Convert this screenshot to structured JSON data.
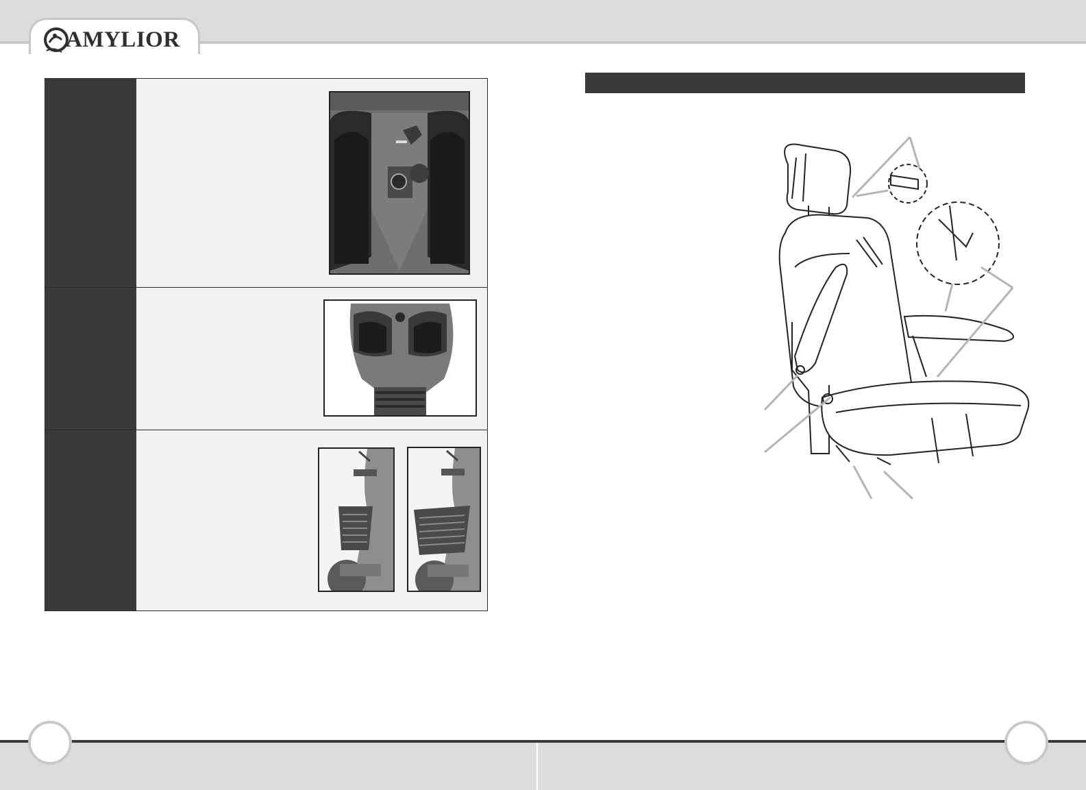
{
  "header": {
    "brand": "AMYLIOR"
  },
  "colors": {
    "band": "#dcdcdc",
    "dark_fill": "#3a3a3a",
    "panel": "#f1f1f1",
    "outline": "#c8c8c8"
  },
  "feature_table": {
    "rows": [
      {
        "photo": "charging-port-photo"
      },
      {
        "photo": "front-console-photo"
      },
      {
        "photo_a": "basket-photo",
        "photo_b": "basket-photo"
      }
    ]
  },
  "diagram": {
    "subject": "adjustable-seat-line-drawing"
  }
}
